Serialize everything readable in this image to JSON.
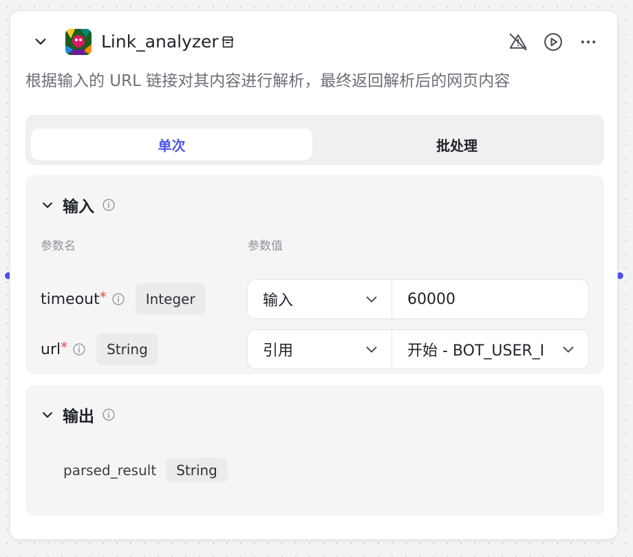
{
  "node": {
    "title": "Link_analyzer",
    "description": "根据输入的 URL 链接对其内容进行解析，最终返回解析后的网页内容",
    "accent": "#4d53e8",
    "icons": [
      "chevron-down-icon",
      "store-icon",
      "alert-off-icon",
      "play-circle-icon",
      "more-horizontal-icon"
    ]
  },
  "tabs": {
    "single": "单次",
    "batch": "批处理",
    "active": "single"
  },
  "input": {
    "title": "输入",
    "col_name": "参数名",
    "col_value": "参数值",
    "params": [
      {
        "name": "timeout",
        "required": "*",
        "type": "Integer",
        "mode": "输入",
        "value": "60000"
      },
      {
        "name": "url",
        "required": "*",
        "type": "String",
        "mode": "引用",
        "value": "开始 - BOT_USER_INPUT"
      }
    ]
  },
  "output": {
    "title": "输出",
    "fields": [
      {
        "name": "parsed_result",
        "type": "String"
      }
    ]
  }
}
